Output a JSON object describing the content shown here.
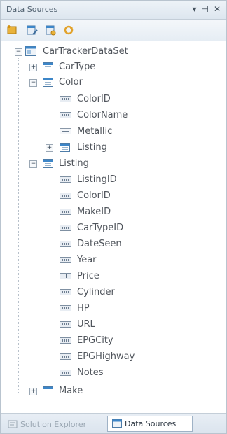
{
  "panel": {
    "title": "Data Sources",
    "controls": {
      "dropdown": "▾",
      "pin": "⊣",
      "close": "✕"
    }
  },
  "toolbar": {
    "buttons": [
      "add-new-data-source-icon",
      "edit-dataset-icon",
      "configure-dataset-icon",
      "refresh-icon"
    ]
  },
  "tree": {
    "root": {
      "label": "CarTrackerDataSet"
    },
    "cartype": {
      "label": "CarType"
    },
    "color": {
      "label": "Color",
      "fields": [
        "ColorID",
        "ColorName",
        "Metallic"
      ],
      "child_table": "Listing"
    },
    "listing": {
      "label": "Listing",
      "fields": [
        "ListingID",
        "ColorID",
        "MakeID",
        "CarTypeID",
        "DateSeen",
        "Year",
        "Price",
        "Cylinder",
        "HP",
        "URL",
        "EPGCity",
        "EPGHighway",
        "Notes"
      ]
    },
    "make": {
      "label": "Make"
    }
  },
  "tabs": {
    "solution_explorer": "Solution Explorer",
    "data_sources": "Data Sources"
  },
  "colors": {
    "accent": "#3d86c8",
    "frame": "#b9c4cf",
    "text": "#50555c"
  }
}
